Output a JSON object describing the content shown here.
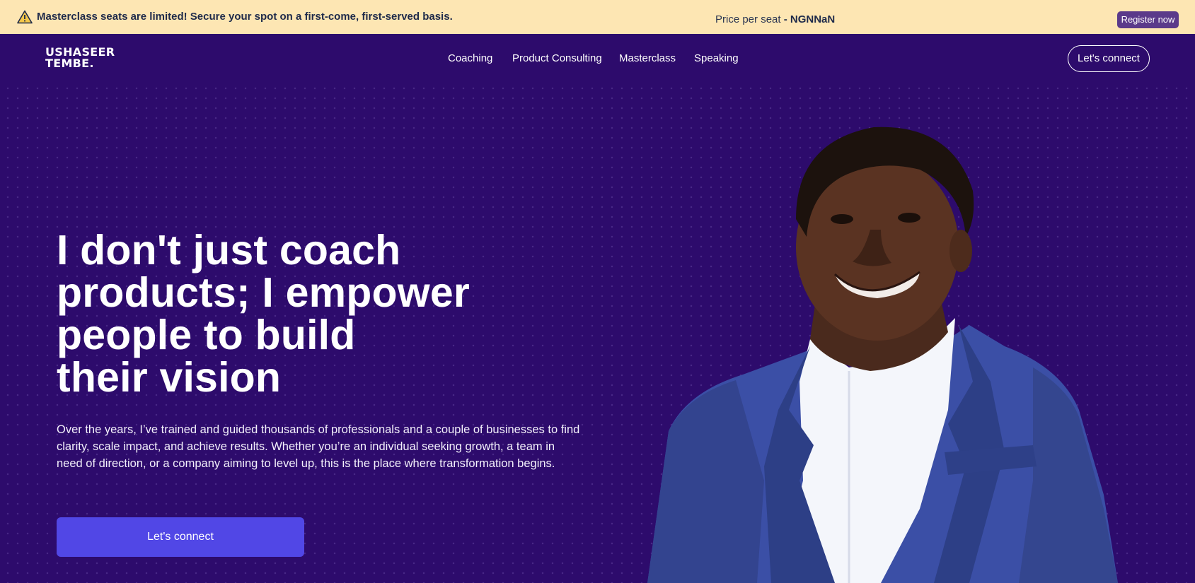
{
  "announcement": {
    "message": "Masterclass seats are limited! Secure your spot on a first-come, first-served basis.",
    "price_label": "Price per seat",
    "price_separator": " - ",
    "price_value": "NGNNaN",
    "register_label": "Register now",
    "icon": "warning-icon",
    "background_color": "#fde6b3"
  },
  "nav": {
    "logo_line1": "USHASEER",
    "logo_line2": "TEMBE.",
    "links": [
      "Coaching",
      "Product Consulting",
      "Masterclass",
      "Speaking"
    ],
    "connect_label": "Let's connect"
  },
  "hero": {
    "headline_lines": [
      "I don't just coach",
      "products; I empower",
      "people to build",
      "their vision"
    ],
    "body": "Over the years, I’ve trained and guided thousands of professionals and a couple of businesses to find clarity, scale impact, and achieve results. Whether you’re an individual seeking growth, a team in need of direction, or a company aiming to level up, this is the place where transformation begins.",
    "cta_label": "Let's connect",
    "background_color": "#2d0b6c",
    "cta_color": "#5147e6"
  }
}
